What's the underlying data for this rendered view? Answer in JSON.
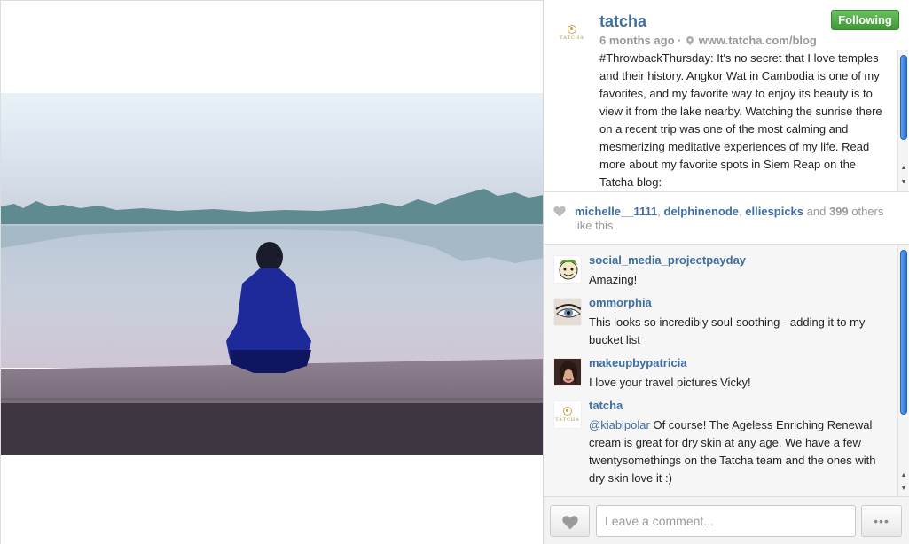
{
  "post": {
    "username": "tatcha",
    "time_ago": "6 months ago",
    "separator": "·",
    "location": "www.tatcha.com/blog",
    "follow_label": "Following",
    "caption": "#ThrowbackThursday: It's no secret that I love temples and their history. Angkor Wat in Cambodia is one of my favorites, and my favorite way to enjoy its beauty is to view it from the lake nearby. Watching the sunrise there on a recent trip was one of the most calming and mesmerizing meditative experiences of my life. Read more about my favorite spots in Siem Reap on the Tatcha blog:",
    "avatar_logo_text": "TATCHA"
  },
  "likes": {
    "user1": "michelle__1111",
    "sep1": ", ",
    "user2": "delphinenode",
    "sep2": ", ",
    "user3": "elliespicks",
    "and": " and ",
    "count": "399",
    "suffix": " others like this."
  },
  "comments": [
    {
      "username": "social_media_projectpayday",
      "text": "Amazing!"
    },
    {
      "username": "ommorphia",
      "text": "This looks so incredibly soul-soothing - adding it to my bucket list"
    },
    {
      "username": "makeupbypatricia",
      "text": "I love your travel pictures Vicky!"
    },
    {
      "username": "tatcha",
      "mention": "@kiabipolar",
      "text": " Of course! The Ageless Enriching Renewal cream is great for dry skin at any age. We have a few twentysomethings on the Tatcha team and the ones with dry skin love it :)"
    }
  ],
  "footer": {
    "comment_placeholder": "Leave a comment...",
    "more_label": "•••"
  },
  "icons": {
    "heart": "heart-icon",
    "pin": "location-pin-icon",
    "scroll_up": "▲",
    "scroll_down": "▼"
  },
  "colors": {
    "link": "#3f6fa0",
    "follow_green": "#4caf42",
    "muted": "#999999"
  }
}
